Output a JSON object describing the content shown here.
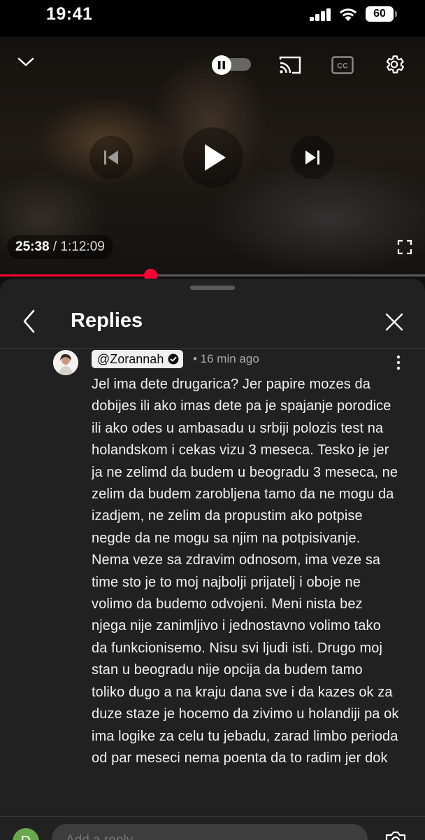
{
  "status_bar": {
    "time": "19:41",
    "battery": "60"
  },
  "player": {
    "current_time": "25:38",
    "total_time": "/ 1:12:09",
    "progress": 0.354,
    "icons": [
      "chevron-down-icon",
      "autoplay-toggle",
      "cast-icon",
      "captions-icon",
      "settings-icon",
      "previous-icon",
      "play-icon",
      "next-icon",
      "fullscreen-icon"
    ]
  },
  "panel": {
    "title": "Replies"
  },
  "comment": {
    "author": "@Zorannah",
    "time_ago": "• 16 min ago",
    "text": "Jel ima dete drugarica? Jer papire mozes da dobijes ili ako imas dete pa je spajanje porodice ili ako odes u ambasadu u srbiji polozis test na holandskom i cekas vizu 3 meseca. Tesko je jer ja ne zelimd da budem u beogradu 3 meseca, ne zelim da budem zarobljena tamo da ne mogu da izadjem, ne zelim da propustim ako potpise negde da ne mogu sa njim na potpisivanje. Nema veze sa zdravim odnosom, ima veze sa time sto je to moj najbolji prijatelj i oboje ne volimo da budemo odvojeni. Meni nista bez njega nije zanimljivo i jednostavno volimo tako da funkcionisemo. Nisu svi ljudi isti. Drugo moj stan u beogradu nije opcija da budem tamo toliko dugo a na kraju dana sve i da kazes ok za duze staze je hocemo da zivimo u holandiji pa ok ima logike za celu tu jebadu, zarad limbo perioda od par meseci nema poenta da to radim jer dok"
  },
  "reply_bar": {
    "avatar_letter": "D",
    "placeholder": "Add a reply..."
  },
  "colors": {
    "accent": "#ff0033",
    "panel_bg": "#212121",
    "page_bg": "#0f0f0f"
  }
}
